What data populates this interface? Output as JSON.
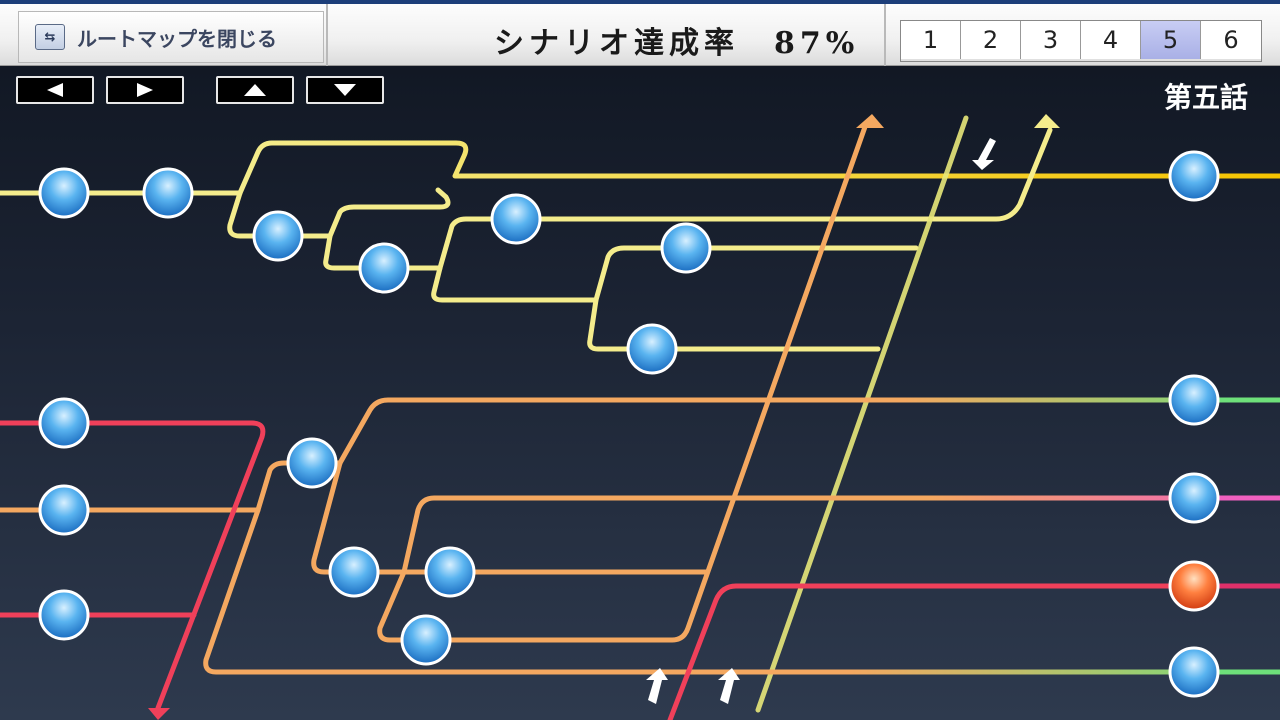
{
  "header": {
    "close_button_label": "ルートマップを閉じる",
    "close_icon": "route-map-icon",
    "completion_text": "シナリオ達成率　87%",
    "chapters": [
      "1",
      "2",
      "3",
      "4",
      "5",
      "6"
    ],
    "active_chapter": "5"
  },
  "nav": {
    "left_icon": "arrow-left-icon",
    "right_icon": "arrow-right-icon",
    "up_icon": "arrow-up-icon",
    "down_icon": "arrow-down-icon"
  },
  "episode_title": "第五話",
  "colors": {
    "yellow_route": "#f4ec8c",
    "orange_route": "#f4a860",
    "red_route": "#f0405a",
    "green_route": "#7ae07a",
    "pink_route": "#f070c0",
    "node_blue": "#2a8ee0",
    "node_orange": "#f05a20",
    "active_tab": "#b0b6ea"
  }
}
